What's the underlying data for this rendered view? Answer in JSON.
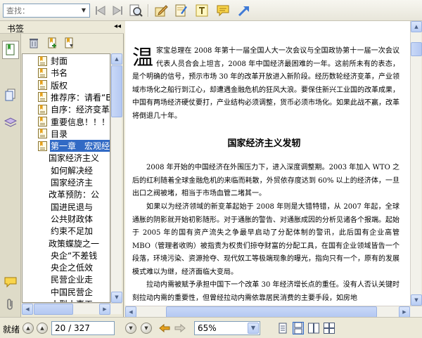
{
  "toolbar": {
    "search_placeholder": "查找：",
    "icons": [
      "search-dropdown",
      "back-icon",
      "forward-icon",
      "find-icon",
      "annotate-icon",
      "note-icon",
      "text-tool-icon",
      "comment-icon",
      "arrow-icon"
    ]
  },
  "sidebar": {
    "title": "书签",
    "collapse_glyph": "◂◂",
    "bookmarks": [
      {
        "label": "封面",
        "level": 0
      },
      {
        "label": "书名",
        "level": 0
      },
      {
        "label": "版权",
        "level": 0
      },
      {
        "label": "推荐序：请看“B",
        "level": 0
      },
      {
        "label": "自序：经济变革",
        "level": 0
      },
      {
        "label": "重要信息！！！",
        "level": 0
      },
      {
        "label": "目录",
        "level": 0
      },
      {
        "label": "第一章　宏观经",
        "level": 0
      },
      {
        "label": "国家经济主义",
        "level": 1
      },
      {
        "label": "如何解决经",
        "level": 2
      },
      {
        "label": "国家经济主",
        "level": 2
      },
      {
        "label": "改革预防：公",
        "level": 1
      },
      {
        "label": "国进民退与",
        "level": 2
      },
      {
        "label": "公共财政体",
        "level": 2
      },
      {
        "label": "约束不足加",
        "level": 2
      },
      {
        "label": "政策蝶旋之一",
        "level": 1
      },
      {
        "label": "央企“不差钱",
        "level": 2
      },
      {
        "label": "央企之低效",
        "level": 2
      },
      {
        "label": "民营企业走",
        "level": 2
      },
      {
        "label": "中国民营企",
        "level": 2
      },
      {
        "label": "小型小事工",
        "level": 2
      }
    ],
    "selected_index": 7
  },
  "document": {
    "dropcap": "温",
    "intro": "家宝总理在 2008 年第十一届全国人大一次会议与全国政协第十一届一次会议代表人员合会上坦言，2008 年中国经济最困难的一年。这前所未有的表态，是个明确的信号，预示市场 30 年的改革开放进入新阶段。经历数轮经济变革，产业领域市场化之船行到江心，却遭遇金融危机的狂风大浪。要保住新兴工业国的改革成果，中国有两场经济硬仗要打，产业结构必须调整，货币必须市场化。如果此战不赢，改革将倒退几十年。",
    "heading": "国家经济主义发轫",
    "para1": "2008 年开始的中国经济在外围压力下，进入深度调整期。2003 年加入 WTO 之后的红利随着全球金融危机的来临而耗散，外贸依存度达到 60% 以上的经济体，一旦出口之阀被堵，相当于市场血管二堵其一。",
    "para2": "如果以为经济领域的新变革起始于 2008 年则是大错特错，从 2007 年起，全球通胀的阴影就开始初影随形。对于通胀的警告、对通胀成因的分析见诸各个报端。起始于 2005 年的国有资产流失之争最早启动了分配体制的警讯，此后国有企业高管 MBO（管理者收购）被指责为权贵们掠夺财富的分配工具，在国有企业领域皆告一个段落，环境污染、资源抢夺、现代奴工等极端现象的曝光，指向只有一个，原有的发展模式难以为继，经济面临大变局。",
    "para3": "拉动内需被赋予承担中国下一个改革 30 年经济增长点的重任。没有人否认关键时刻拉动内需的重要性，但曾经拉动内需依靠居民消费的主要手段，如房地"
  },
  "statusbar": {
    "status": "就绪",
    "page_display": "20 / 327",
    "current_page": 20,
    "total_pages": 327,
    "zoom": "65%"
  },
  "colors": {
    "selection": "#316ac5",
    "chrome": "#ece9d8",
    "scroll_accent": "#b8cdf4"
  }
}
